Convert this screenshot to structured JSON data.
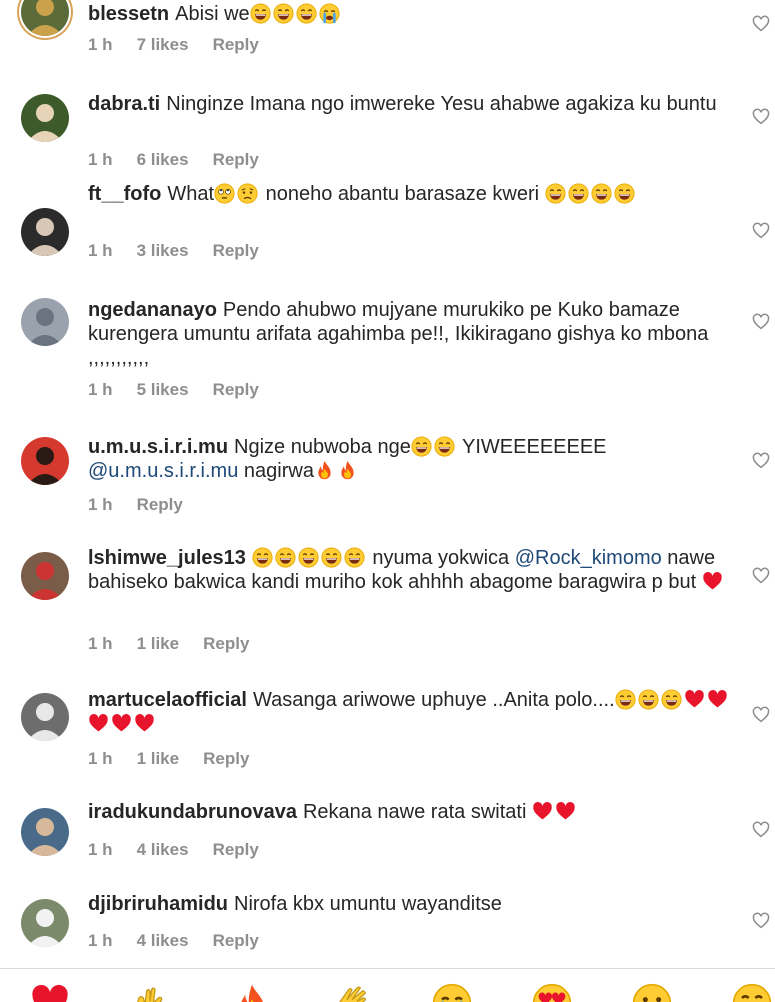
{
  "comments": [
    {
      "user": "blessetn",
      "segments": [
        {
          "t": "Abisi we"
        },
        {
          "e": "laugh"
        },
        {
          "e": "laugh"
        },
        {
          "e": "laugh"
        },
        {
          "e": "cry"
        }
      ],
      "time": "1 h",
      "likes": "7 likes",
      "reply": "Reply"
    },
    {
      "user": "dabra.ti",
      "segments": [
        {
          "t": "Ninginze Imana ngo imwereke Yesu ahabwe agakiza ku buntu"
        }
      ],
      "time": "1 h",
      "likes": "6 likes",
      "reply": "Reply"
    },
    {
      "user": "ft__fofo",
      "segments": [
        {
          "t": "What"
        },
        {
          "e": "rolleyes"
        },
        {
          "e": "worried"
        },
        {
          "t": " noneho abantu barasaze kweri "
        },
        {
          "e": "laugh"
        },
        {
          "e": "laugh"
        },
        {
          "e": "laugh"
        },
        {
          "e": "laugh"
        }
      ],
      "time": "1 h",
      "likes": "3 likes",
      "reply": "Reply"
    },
    {
      "user": "ngedananayo",
      "segments": [
        {
          "t": "Pendo ahubwo mujyane murukiko pe Kuko bamaze kurengera umuntu arifata agahimba pe!!, Ikikiragano gishya ko mbona ,,,,,,,,,,,"
        }
      ],
      "time": "1 h",
      "likes": "5 likes",
      "reply": "Reply"
    },
    {
      "user": "u.m.u.s.i.r.i.mu",
      "segments": [
        {
          "t": "Ngize nubwoba nge"
        },
        {
          "e": "laugh"
        },
        {
          "e": "laugh"
        },
        {
          "t": " YIWEEEEEEEE "
        },
        {
          "m": "@u.m.u.s.i.r.i.mu"
        },
        {
          "t": "  nagirwa"
        },
        {
          "e": "fire"
        },
        {
          "e": "fire"
        }
      ],
      "time": "1 h",
      "likes": "",
      "reply": "Reply"
    },
    {
      "user": "lshimwe_jules13",
      "segments": [
        {
          "e": "laugh"
        },
        {
          "e": "laugh"
        },
        {
          "e": "laugh"
        },
        {
          "e": "laugh"
        },
        {
          "e": "laugh"
        },
        {
          "t": " nyuma yokwica "
        },
        {
          "m": "@Rock_kimomo"
        },
        {
          "t": "  nawe bahiseko bakwica kandi muriho kok ahhhh abagome baragwira p but "
        },
        {
          "e": "heart"
        }
      ],
      "time": "1 h",
      "likes": "1 like",
      "reply": "Reply"
    },
    {
      "user": "martucelaofficial",
      "segments": [
        {
          "t": "Wasanga ariwowe uphuye ..Anita polo...."
        },
        {
          "e": "laugh"
        },
        {
          "e": "laugh"
        },
        {
          "e": "laugh"
        },
        {
          "e": "heart"
        },
        {
          "e": "heart"
        },
        {
          "e": "heart"
        },
        {
          "e": "heart"
        },
        {
          "e": "heart"
        }
      ],
      "time": "1 h",
      "likes": "1 like",
      "reply": "Reply"
    },
    {
      "user": "iradukundabrunovava",
      "segments": [
        {
          "t": "Rekana nawe rata switati "
        },
        {
          "e": "heart"
        },
        {
          "e": "heart"
        }
      ],
      "time": "1 h",
      "likes": "4 likes",
      "reply": "Reply"
    },
    {
      "user": "djibriruhamidu",
      "segments": [
        {
          "t": "Nirofa kbx umuntu wayanditse"
        }
      ],
      "time": "1 h",
      "likes": "4 likes",
      "reply": "Reply"
    }
  ],
  "reactions": [
    "heart",
    "raised-hands",
    "fire",
    "clap",
    "cry",
    "heart-eyes",
    "surprised",
    "laugh"
  ],
  "colors": {
    "text": "#262626",
    "meta": "#8e8e8e",
    "mention": "#1f4a78",
    "divider": "#dbdbdb"
  }
}
